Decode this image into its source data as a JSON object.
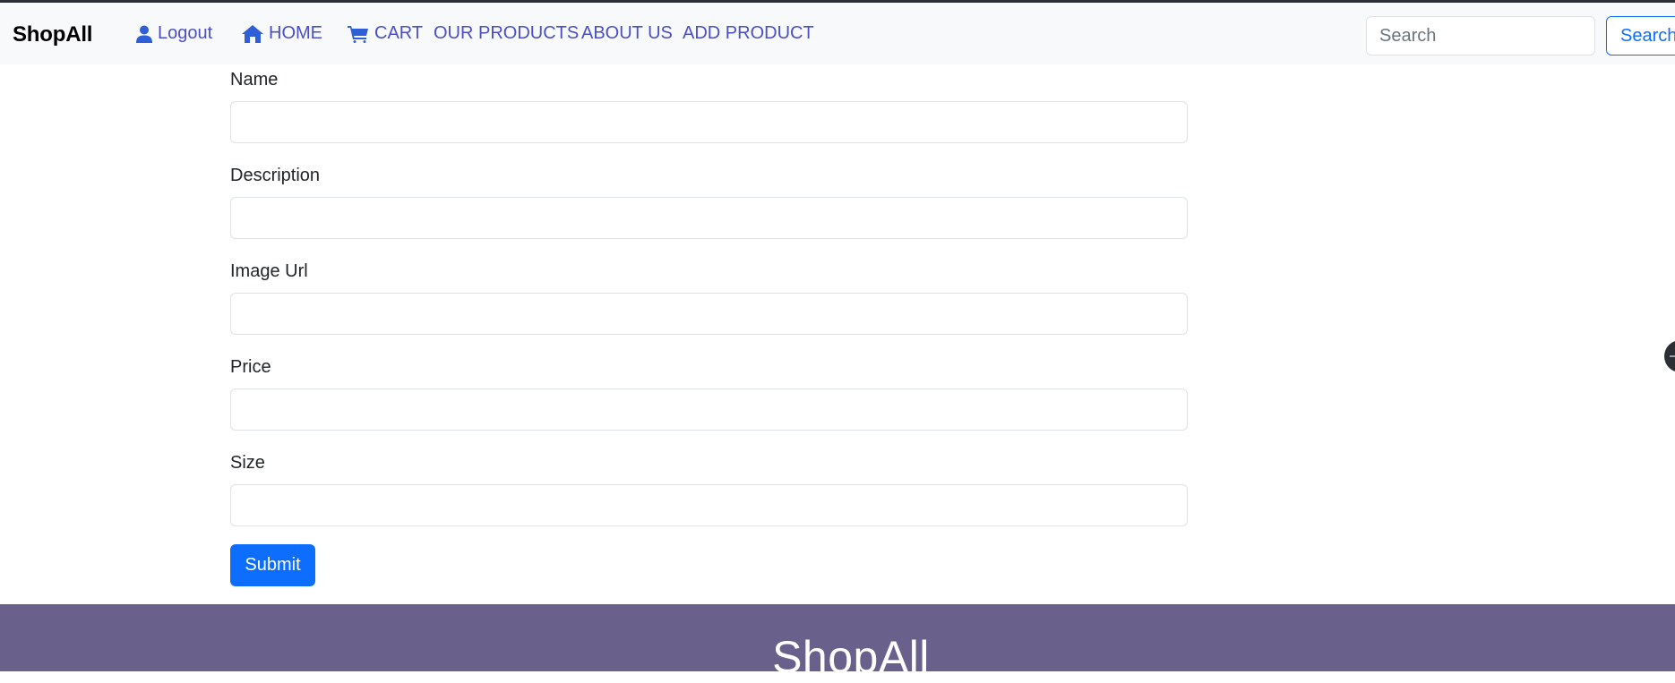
{
  "navbar": {
    "brand": "ShopAll",
    "logout_label": "Logout",
    "home_label": "HOME",
    "cart_label": "CART",
    "products_label": "OUR PRODUCTS",
    "about_label": "ABOUT US",
    "add_product_label": "ADD PRODUCT",
    "search_placeholder": "Search",
    "search_button_label": "Search"
  },
  "form": {
    "fields": [
      {
        "label": "Name",
        "value": ""
      },
      {
        "label": "Description",
        "value": ""
      },
      {
        "label": "Image Url",
        "value": ""
      },
      {
        "label": "Price",
        "value": ""
      },
      {
        "label": "Size",
        "value": ""
      }
    ],
    "submit_label": "Submit"
  },
  "footer": {
    "title": "ShopAll"
  },
  "colors": {
    "link": "#4a4fc9",
    "primary": "#0d6efd",
    "footer_bg": "#6a608c",
    "navbar_bg": "#f8f9fa"
  },
  "icons": {
    "logout": "user-icon",
    "home": "home-icon",
    "cart": "cart-icon"
  }
}
